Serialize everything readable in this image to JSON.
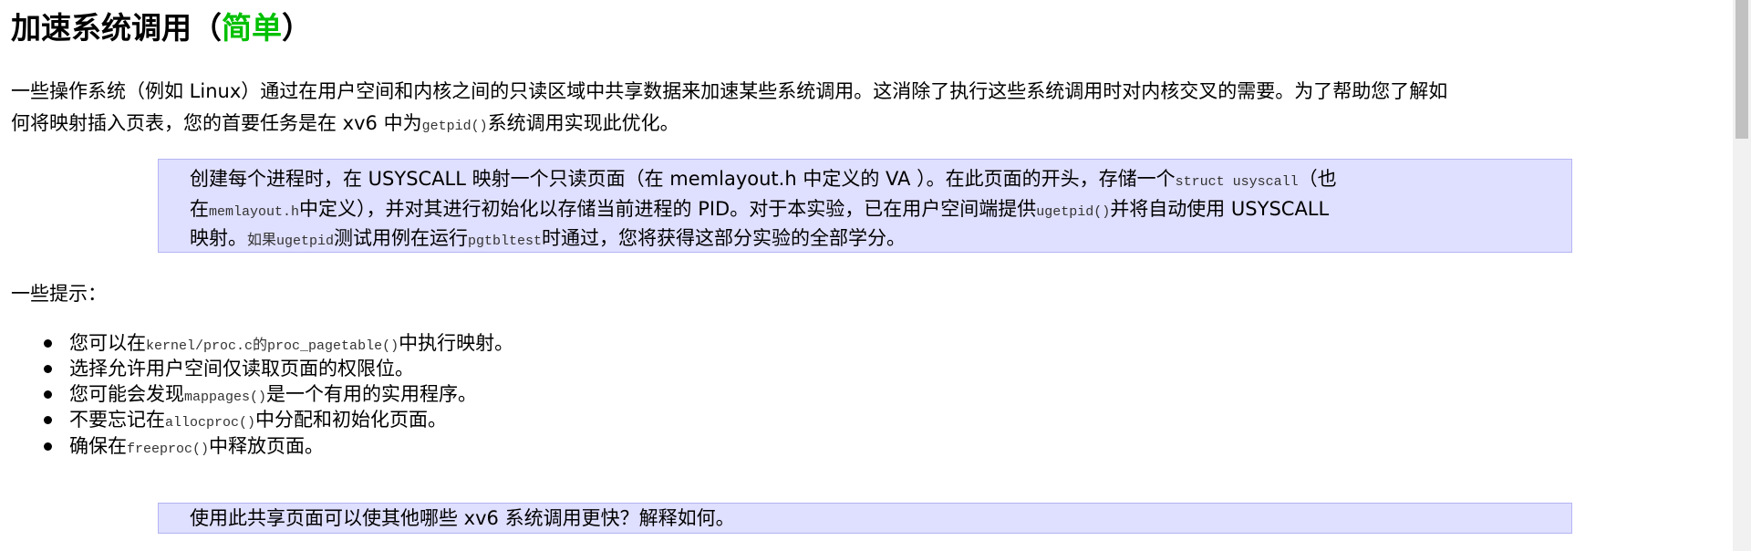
{
  "title": {
    "main": "加速系统调用（",
    "difficulty": "简单",
    "close": "）",
    "difficulty_color": "#00c000"
  },
  "intro": {
    "l1": "一些操作系统（例如 Linux）通过在用户空间和内核之间的只读区域中共享数据来加速某些系统调用。这消除了执行这些系统调用时对内核交叉的需要。为了帮助您了解如",
    "l2a": "何将映射插入页表，您的首要任务是在 xv6 中为",
    "l2code": "getpid()",
    "l2b": "系统调用实现此优化。"
  },
  "task_box": {
    "l1a": "创建每个进程时，在 USYSCALL 映射一个只读页面（在 memlayout.h 中定义的 VA ）。在此页面的开头，存储一个",
    "l1code": "struct usyscall",
    "l1b": "（也",
    "l2a": "在",
    "l2code1": "memlayout.h",
    "l2b": "中定义），并对其进行初始化以存储当前进程的 PID。对于本实验，已在用户空间端提供",
    "l2code2": "ugetpid()",
    "l2c": "并将自动使用 USYSCALL",
    "l3a": "映射。",
    "l3small": "如果",
    "l3code1": "ugetpid",
    "l3b": "测试用例在运行",
    "l3code2": "pgtbltest",
    "l3c": "时通过，您将获得这部分实验的全部学分。"
  },
  "hints_label": "一些提示：",
  "hints": [
    {
      "a": "您可以在",
      "code1": "kernel/proc.c",
      "b": "的",
      "code2": "proc_pagetable()",
      "c": "中执行映射。"
    },
    {
      "a": "选择允许用户空间仅读取页面的权限位。"
    },
    {
      "a": "您可能会发现",
      "code1": "mappages()",
      "b": "是一个有用的实用程序。"
    },
    {
      "a": "不要忘记在",
      "code1": "allocproc()",
      "b": "中分配和初始化页面。"
    },
    {
      "a": "确保在",
      "code1": "freeproc()",
      "b": "中释放页面。"
    }
  ],
  "question_box": "使用此共享页面可以使其他哪些 xv6 系统调用更快？解释如何。"
}
